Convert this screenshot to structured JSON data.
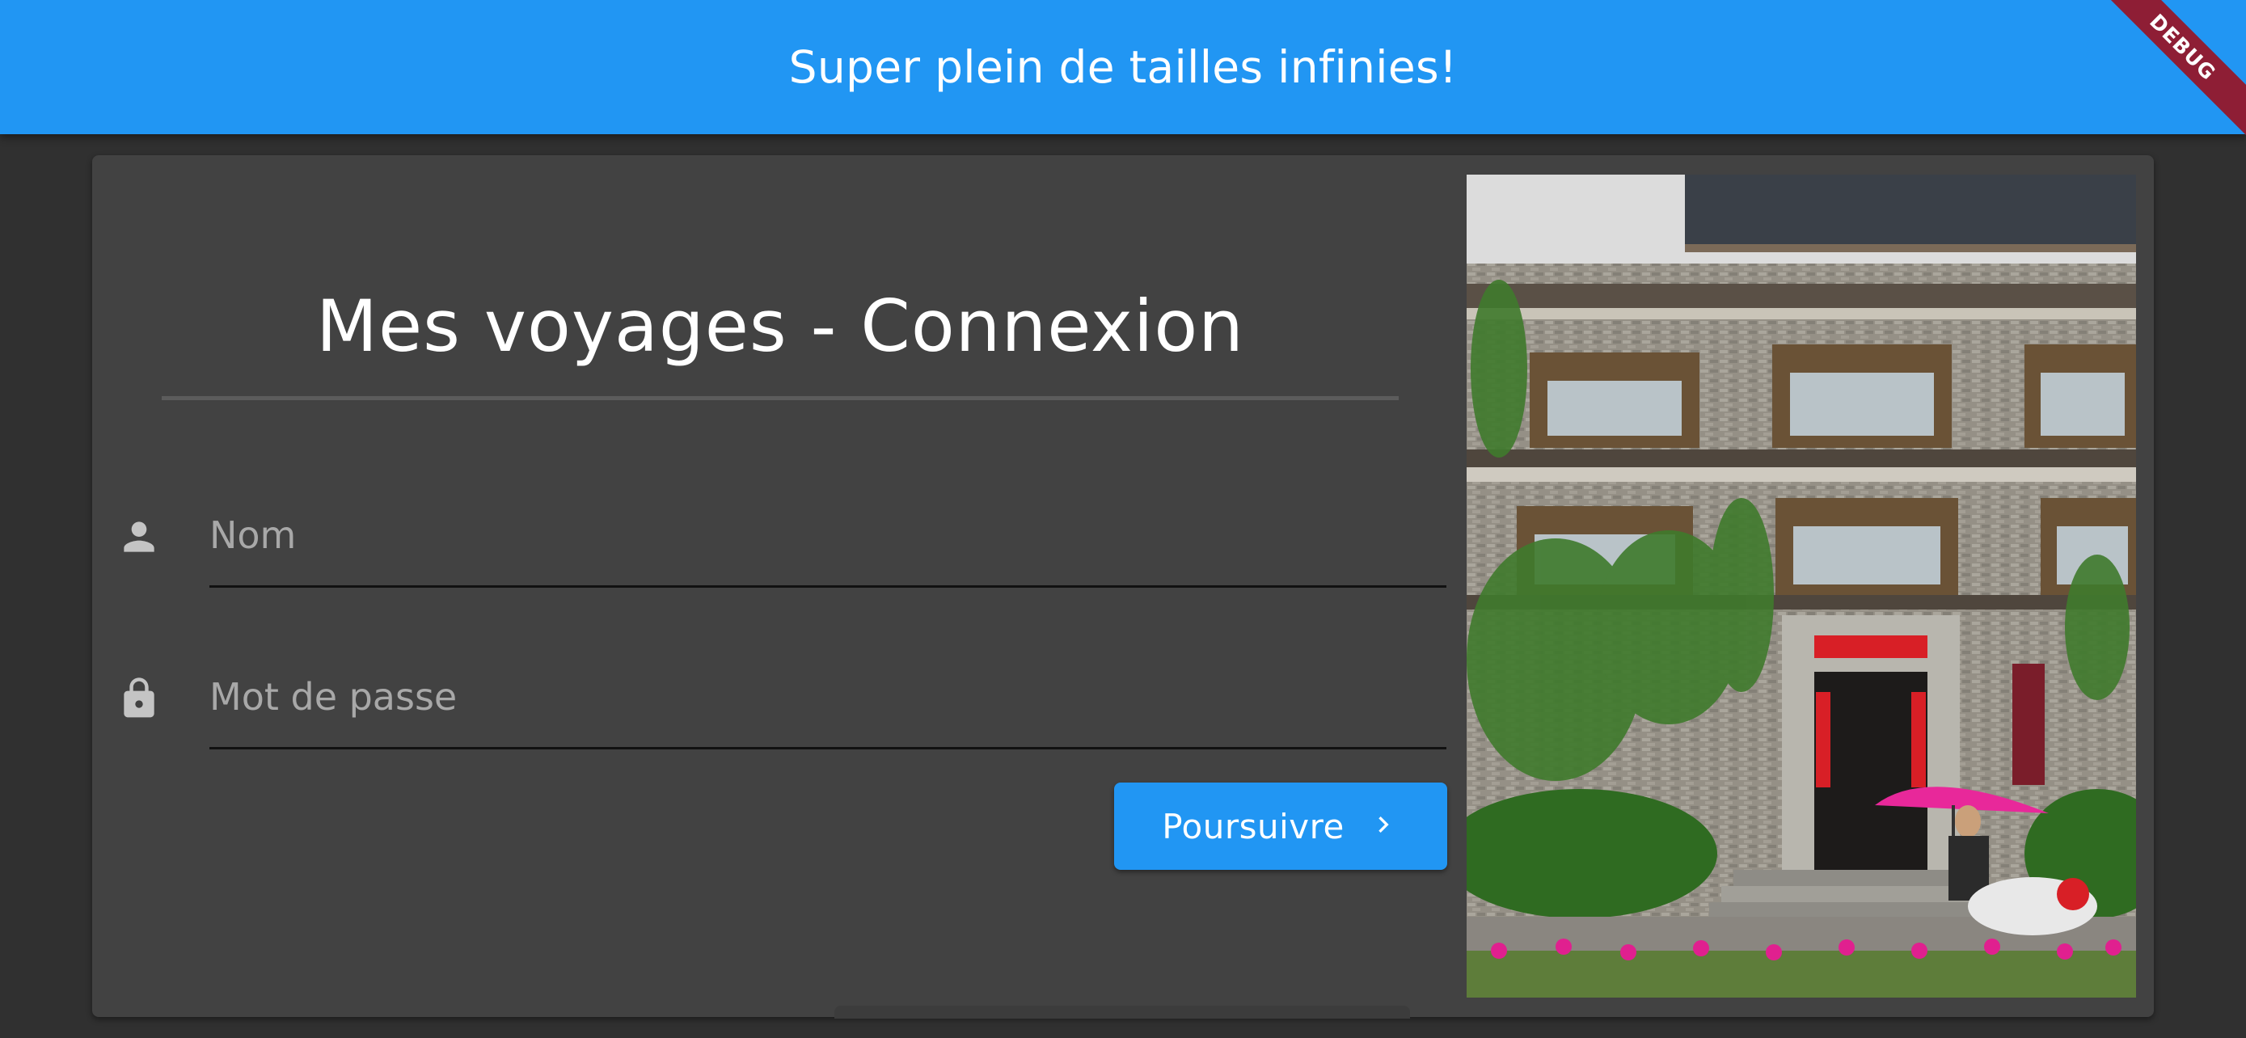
{
  "appbar": {
    "title": "Super plein de tailles infinies!",
    "color": "#2196F3"
  },
  "debug_banner": {
    "label": "DEBUG",
    "color": "#8E1E35"
  },
  "login": {
    "title": "Mes voyages - Connexion",
    "name_field": {
      "icon": "person-icon",
      "placeholder": "Nom",
      "value": ""
    },
    "password_field": {
      "icon": "lock-icon",
      "placeholder": "Mot de passe",
      "value": ""
    },
    "submit_button": {
      "label": "Poursuivre",
      "icon": "chevron-right-icon"
    }
  },
  "photo": {
    "subject": "Traditional Chinese guesthouse facade with ivy and a scooter rider under a pink umbrella"
  },
  "colors": {
    "background": "#303030",
    "card": "#424242",
    "accent": "#2196F3"
  }
}
